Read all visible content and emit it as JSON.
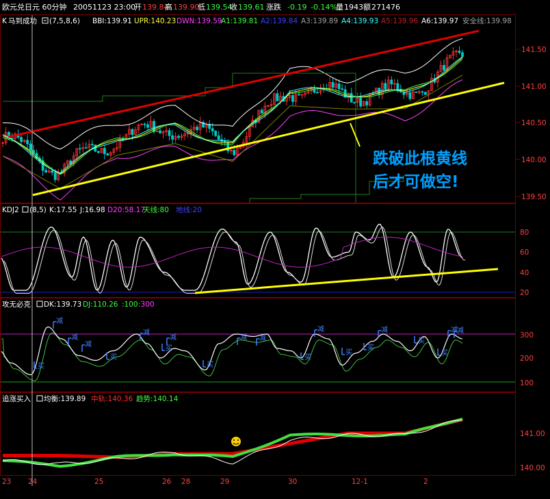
{
  "colors": {
    "bg": "#000000",
    "frame": "#7a0000",
    "white": "#ffffff",
    "up": "#ff3030",
    "down": "#00c8c8",
    "yellow": "#ffff00",
    "magenta": "#ff40ff",
    "green": "#40c040",
    "blue": "#4040ff",
    "limegreen": "#40e040",
    "red": "#e00000",
    "annotation": "#00a0ff"
  },
  "header": {
    "title": "欧元兑日元 60分钟",
    "datetime": "20051123 23:00",
    "open_label": "开",
    "open": "139.84",
    "high_label": "高",
    "high": "139.90",
    "low_label": "低",
    "low": "139.54",
    "close_label": "收",
    "close": "139.61",
    "change_label": "涨跌",
    "change": "-0.19",
    "change_pct": "-0.14%",
    "volume_label": "量",
    "volume": "1943",
    "amount_label": "额",
    "amount": "271476"
  },
  "panels": {
    "main": {
      "tag": "K",
      "indicator": "马到成功",
      "params": "(7,5,8,6)",
      "bbi": "BBI:139.91",
      "upr": "UPR:140.23",
      "dwn": "DWN:139.59",
      "a1": "A1:139.81",
      "a2": "A2:139.84",
      "a3": "A3:139.89",
      "a4": "A4:139.93",
      "a5": "A5:139.96",
      "a6": "A6:139.97",
      "safe": "安全线:139.98",
      "annotation_line1": "跌破此根黄线",
      "annotation_line2": "后才可做空!",
      "axis_labels": [
        "141.50",
        "141.00",
        "140.50",
        "140.00",
        "139.50"
      ]
    },
    "kdj": {
      "indicator": "KDJ2",
      "params": "(8,5)",
      "k": "K:17.55",
      "j": "J:16.98",
      "d20": "D20:58.17",
      "tianxian": "天线:80",
      "dixian": "地线:20",
      "axis_labels": [
        "80",
        "60",
        "40",
        "20"
      ]
    },
    "gong": {
      "indicator": "攻无必克",
      "dk": "DK:139.73",
      "dj": "DJ:110.26",
      "l1": ":100",
      "l2": ":300",
      "axis_labels": [
        "300",
        "200",
        "100"
      ],
      "buy_label": "买",
      "sell_label": "减"
    },
    "zhui": {
      "indicator": "追涨买入",
      "junheng": "均衡:139.89",
      "zhongjun": "中轨:140.36",
      "qushi": "趋势:140.14",
      "axis_labels": [
        "141.00",
        "140.00"
      ]
    }
  },
  "x_axis": {
    "labels": [
      "23",
      "24",
      "25",
      "26",
      "28",
      "29",
      "30",
      "12-1",
      "2"
    ]
  },
  "chart_data": [
    {
      "type": "line",
      "title": "马到成功 (7,5,8,6)",
      "xlabel": "",
      "ylabel": "",
      "x": [
        "23",
        "24",
        "25",
        "26",
        "28",
        "29",
        "30",
        "12-1",
        "2"
      ],
      "series": [
        {
          "name": "BBI",
          "values": [
            140.3,
            139.85,
            140.3,
            140.45,
            140.2,
            140.95,
            140.9,
            140.9,
            141.35
          ]
        },
        {
          "name": "UPR",
          "values": [
            140.5,
            140.2,
            140.5,
            140.7,
            140.4,
            141.25,
            141.1,
            141.2,
            141.6
          ]
        },
        {
          "name": "DWN",
          "values": [
            140.1,
            139.55,
            140.1,
            140.2,
            140.0,
            140.65,
            140.7,
            140.6,
            141.1
          ]
        }
      ],
      "ylim": [
        139.4,
        141.8
      ],
      "legend": "top-left"
    },
    {
      "type": "line",
      "title": "KDJ2 (8,5)",
      "xlabel": "",
      "ylabel": "",
      "x": [
        "23",
        "24",
        "25",
        "26",
        "28",
        "29",
        "30",
        "12-1",
        "2"
      ],
      "series": [
        {
          "name": "K",
          "values": [
            40,
            20,
            75,
            35,
            20,
            80,
            25,
            80,
            17.55
          ]
        },
        {
          "name": "J",
          "values": [
            42,
            18,
            78,
            32,
            18,
            82,
            22,
            83,
            16.98
          ]
        },
        {
          "name": "D20",
          "values": [
            55,
            50,
            60,
            55,
            50,
            62,
            60,
            70,
            58.17
          ]
        }
      ],
      "ylim": [
        15,
        90
      ],
      "legend": "top-left"
    },
    {
      "type": "line",
      "title": "攻无必克",
      "xlabel": "",
      "ylabel": "",
      "x": [
        "23",
        "24",
        "25",
        "26",
        "28",
        "29",
        "30",
        "12-1",
        "2"
      ],
      "series": [
        {
          "name": "DK",
          "values": [
            220,
            170,
            290,
            230,
            200,
            290,
            220,
            300,
            280
          ]
        },
        {
          "name": "DJ",
          "values": [
            200,
            140,
            300,
            200,
            160,
            300,
            180,
            300,
            110.26
          ]
        }
      ],
      "ylim": [
        80,
        360
      ],
      "legend": "top-left"
    },
    {
      "type": "line",
      "title": "追涨买入",
      "xlabel": "",
      "ylabel": "",
      "x": [
        "23",
        "24",
        "25",
        "26",
        "28",
        "29",
        "30",
        "12-1",
        "2"
      ],
      "series": [
        {
          "name": "均衡",
          "values": [
            140.2,
            140.1,
            140.25,
            140.45,
            140.15,
            140.8,
            140.95,
            140.95,
            141.4
          ]
        },
        {
          "name": "中轨",
          "values": [
            140.35,
            140.35,
            140.3,
            140.4,
            140.4,
            140.7,
            141.0,
            141.0,
            141.4
          ]
        },
        {
          "name": "趋势",
          "values": [
            140.2,
            140.05,
            140.3,
            140.4,
            140.3,
            140.95,
            140.95,
            140.95,
            141.45
          ]
        }
      ],
      "ylim": [
        139.8,
        141.6
      ],
      "legend": "top-left"
    }
  ]
}
